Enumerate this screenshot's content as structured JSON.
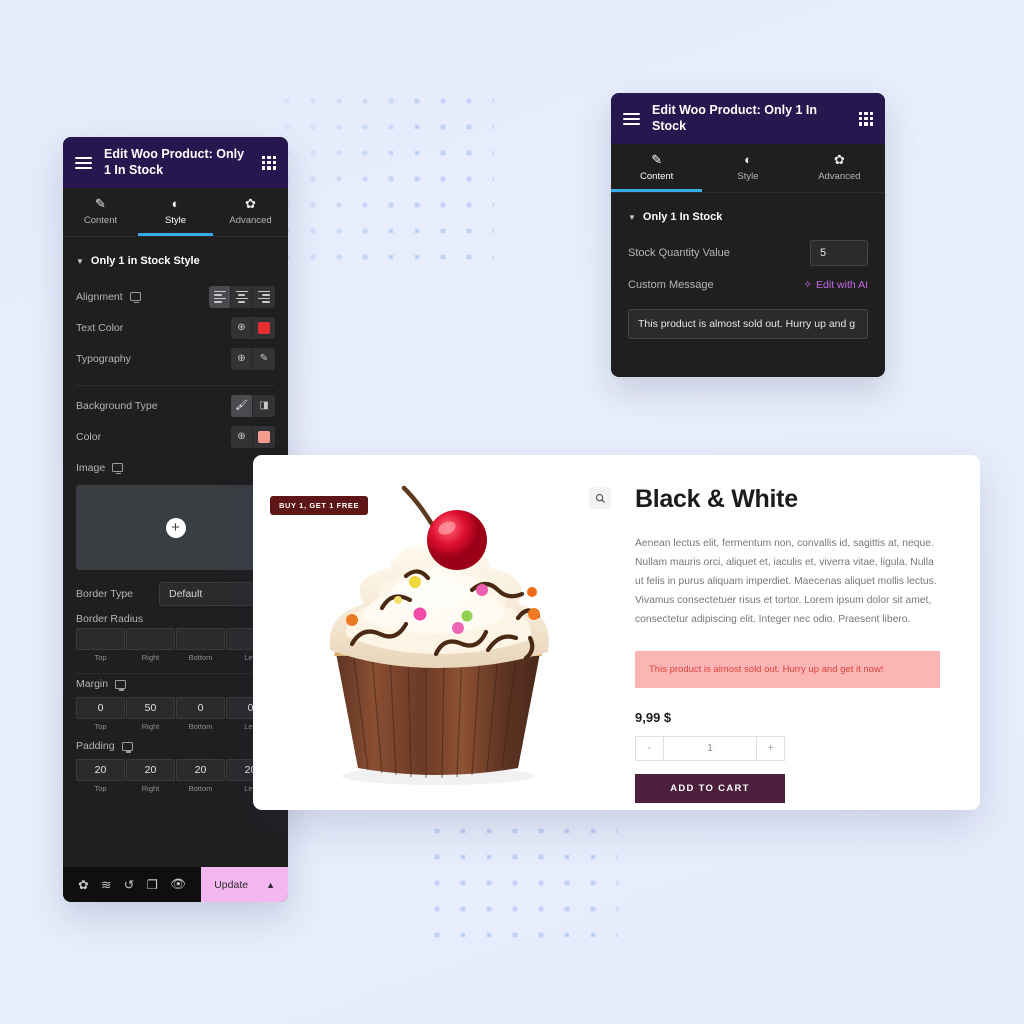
{
  "left_panel": {
    "header": {
      "title": "Edit Woo Product: Only 1 In Stock",
      "menu_icon": "hamburger-icon",
      "grid_icon": "grid-apps-icon"
    },
    "tabs": [
      {
        "label": "Content",
        "icon": "pencil-icon",
        "active": false
      },
      {
        "label": "Style",
        "icon": "contrast-icon",
        "active": true
      },
      {
        "label": "Advanced",
        "icon": "gear-icon",
        "active": false
      }
    ],
    "section_title": "Only 1 in Stock Style",
    "controls": {
      "alignment_label": "Alignment",
      "text_color_label": "Text Color",
      "text_color_value": "#e62e2e",
      "typography_label": "Typography",
      "background_type_label": "Background Type",
      "color_label": "Color",
      "color_value": "#f59e8f",
      "image_label": "Image",
      "border_type_label": "Border Type",
      "border_type_value": "Default",
      "border_radius_label": "Border Radius",
      "margin_label": "Margin",
      "padding_label": "Padding"
    },
    "dimension_labels": [
      "Top",
      "Right",
      "Bottom",
      "Left"
    ],
    "border_radius_values": [
      "",
      "",
      "",
      ""
    ],
    "margin_values": [
      "0",
      "50",
      "0",
      "0"
    ],
    "padding_values": [
      "20",
      "20",
      "20",
      "20"
    ],
    "footer": {
      "icons": [
        "settings-gear-icon",
        "layers-icon",
        "history-icon",
        "responsive-icon",
        "preview-eye-icon"
      ],
      "update_label": "Update",
      "update_chevron": "⌃",
      "update_color": "#f3b8ef"
    }
  },
  "right_panel": {
    "header": {
      "title": "Edit Woo Product: Only 1 In Stock"
    },
    "tabs": [
      {
        "label": "Content",
        "icon": "pencil-icon",
        "active": true
      },
      {
        "label": "Style",
        "icon": "contrast-icon",
        "active": false
      },
      {
        "label": "Advanced",
        "icon": "gear-icon",
        "active": false
      }
    ],
    "section_title": "Only 1 In Stock",
    "stock_quantity_label": "Stock Quantity Value",
    "stock_quantity_value": "5",
    "custom_message_label": "Custom Message",
    "edit_with_ai_label": "Edit with AI",
    "custom_message_value": "This product is almost sold out. Hurry up and g"
  },
  "product_card": {
    "badge": "BUY 1, GET 1 FREE",
    "zoom_icon": "magnifier-icon",
    "title": "Black & White",
    "description": "Aenean lectus elit, fermentum non, convallis id, sagittis at, neque. Nullam mauris orci, aliquet et, iaculis et, viverra vitae, ligula. Nulla ut felis in purus aliquam imperdiet. Maecenas aliquet mollis lectus. Vivamus consectetuer risus et tortor. Lorem ipsum dolor sit amet, consectetur adipiscing elit. Integer nec odio. Praesent libero.",
    "stock_alert": "This product is almost sold out. Hurry up and get it now!",
    "stock_alert_bg": "#fcb5b5",
    "stock_alert_color": "#d8443d",
    "price": "9,99 $",
    "qty_minus": "-",
    "qty_value": "1",
    "qty_plus": "+",
    "add_to_cart_label": "ADD TO CART",
    "add_to_cart_color": "#4c1f3c",
    "image_alt": "cupcake-photo"
  },
  "theme": {
    "page_bg": "#e9eefc",
    "dot_color": "#c2d2f6",
    "panel_header_bg": "#26174f",
    "panel_bg": "#1f1f20",
    "accent_blue": "#39a9e8"
  }
}
